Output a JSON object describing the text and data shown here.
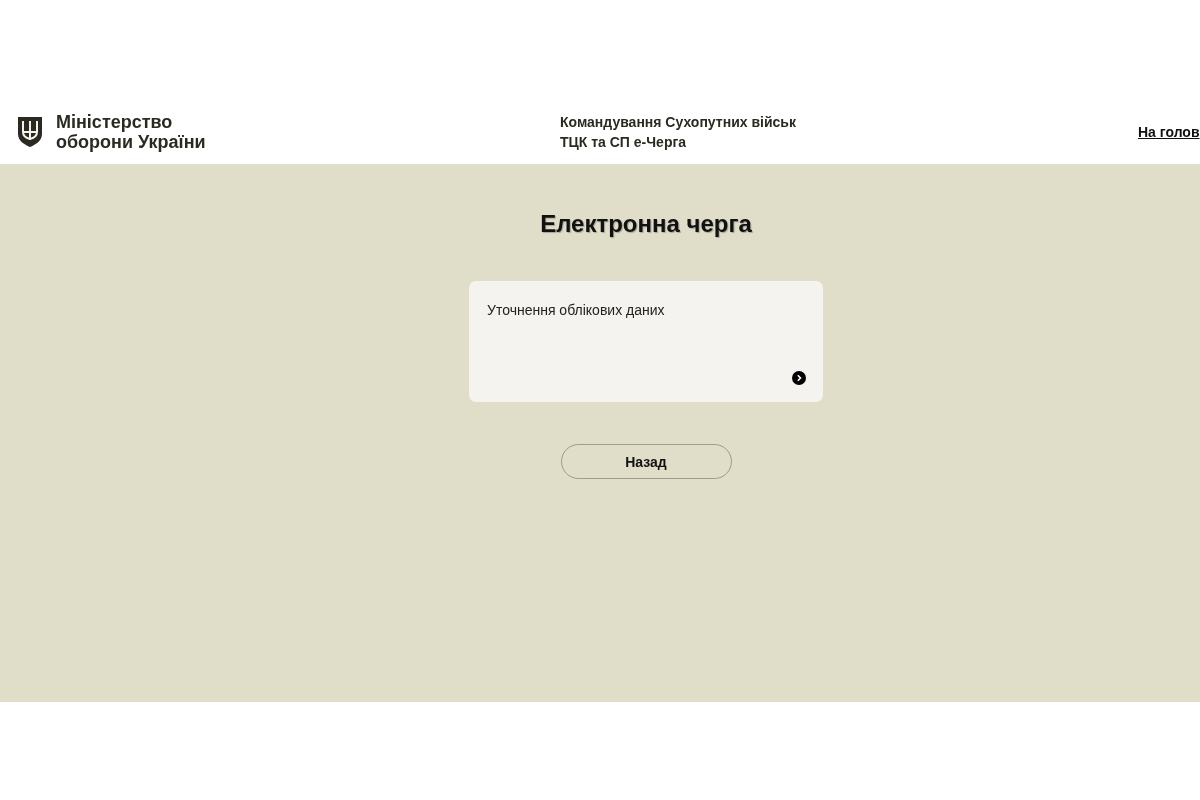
{
  "header": {
    "ministry_name": [
      "Міністерство",
      "оборони України"
    ],
    "command_name": "Командування Сухопутних військ",
    "service_name": "ТЦК та СП е-Черга",
    "home_link": "На голов"
  },
  "page_title": "Електронна черга",
  "services": [
    {
      "title": "Уточнення облікових даних"
    }
  ],
  "back_button": "Назад"
}
